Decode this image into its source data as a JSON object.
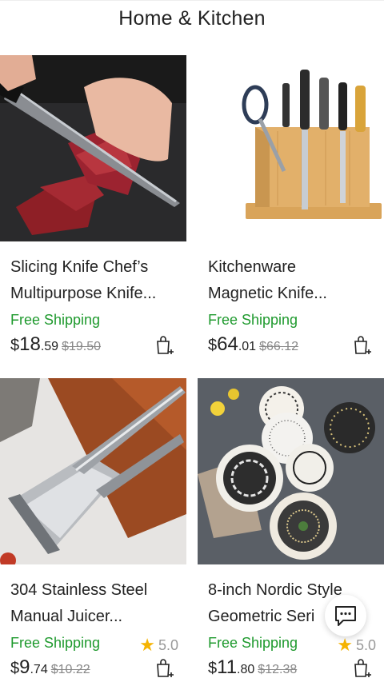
{
  "header": {
    "title": "Home & Kitchen"
  },
  "products": [
    {
      "title_line1": "Slicing Knife Chef’s",
      "title_line2": "Multipurpose Knife...",
      "shipping": "Free Shipping",
      "rating": "",
      "currency": "$",
      "price_whole": "18",
      "price_cents": ".59",
      "old_price": "$19.50"
    },
    {
      "title_line1": "Kitchenware",
      "title_line2": "Magnetic Knife...",
      "shipping": "Free Shipping",
      "rating": "",
      "currency": "$",
      "price_whole": "64",
      "price_cents": ".01",
      "old_price": "$66.12"
    },
    {
      "title_line1": "304 Stainless Steel",
      "title_line2": "Manual Juicer...",
      "shipping": "Free Shipping",
      "rating": "5.0",
      "currency": "$",
      "price_whole": "9",
      "price_cents": ".74",
      "old_price": "$10.22"
    },
    {
      "title_line1": "8-inch Nordic Style",
      "title_line2": "Geometric Seri",
      "shipping": "Free Shipping",
      "rating": "5.0",
      "currency": "$",
      "price_whole": "11",
      "price_cents": ".80",
      "old_price": "$12.38"
    }
  ],
  "icons": {
    "cart": "add-to-cart-icon",
    "star": "star-icon",
    "chat": "chat-icon"
  },
  "colors": {
    "shipping_green": "#1f9a2e",
    "star_yellow": "#f5b301"
  }
}
